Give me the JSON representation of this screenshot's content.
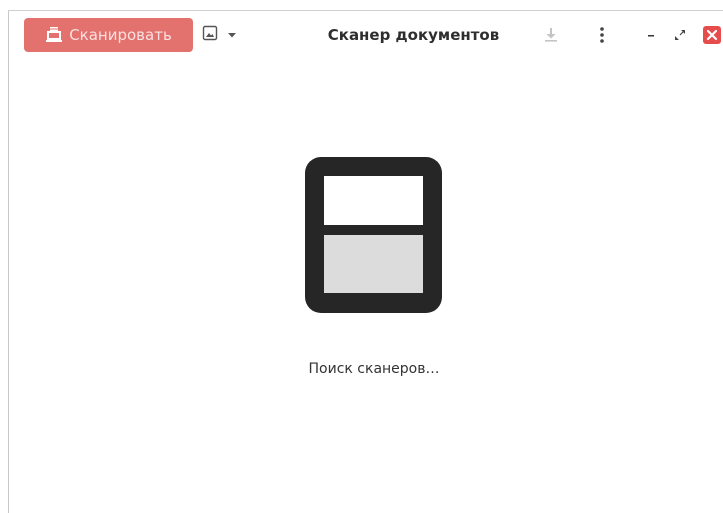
{
  "window": {
    "title": "Сканер документов"
  },
  "toolbar": {
    "scan_label": "Сканировать",
    "scan_icon": "scanner-icon",
    "document_type_icon": "image-icon",
    "dropdown_icon": "chevron-down-icon",
    "save_icon": "download-icon",
    "menu_icon": "vertical-dots-icon",
    "minimize_icon": "minimize-icon",
    "restore_icon": "restore-icon",
    "close_icon": "close-icon"
  },
  "main": {
    "status_text": "Поиск сканеров…",
    "illustration_icon": "scanner-page-icon"
  },
  "colors": {
    "accent": "#e3716e",
    "close": "#e74c4c",
    "illustration_dark": "#262626",
    "illustration_fill": "#dcdcdc"
  }
}
